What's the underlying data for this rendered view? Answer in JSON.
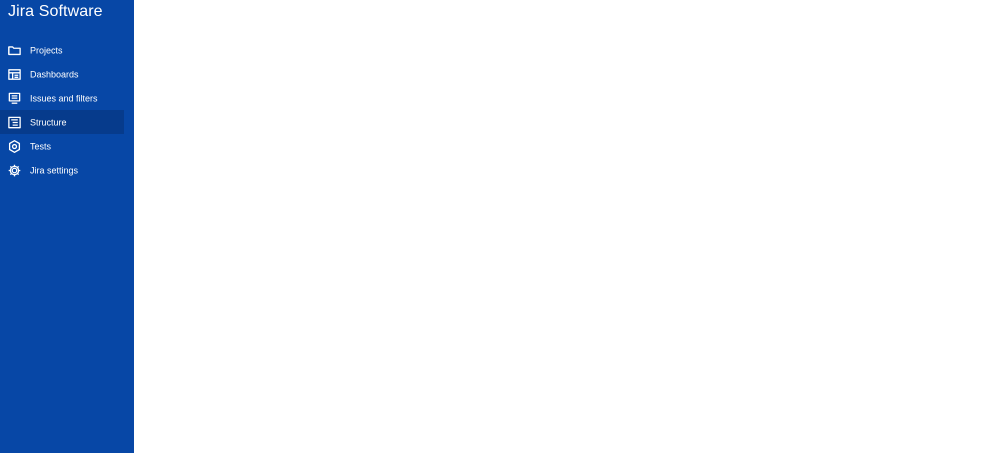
{
  "app": {
    "product_name": "Jira Software",
    "sidebar_color": "#0747a6",
    "active_item_color": "#063b8c"
  },
  "sidebar": {
    "items": [
      {
        "label": "Projects",
        "icon": "folder-icon",
        "active": false
      },
      {
        "label": "Dashboards",
        "icon": "dashboard-icon",
        "active": false
      },
      {
        "label": "Issues and filters",
        "icon": "issues-filter-icon",
        "active": false
      },
      {
        "label": "Structure",
        "icon": "structure-icon",
        "active": true
      },
      {
        "label": "Tests",
        "icon": "tests-icon",
        "active": false
      },
      {
        "label": "Jira settings",
        "icon": "gear-icon",
        "active": false
      }
    ]
  }
}
